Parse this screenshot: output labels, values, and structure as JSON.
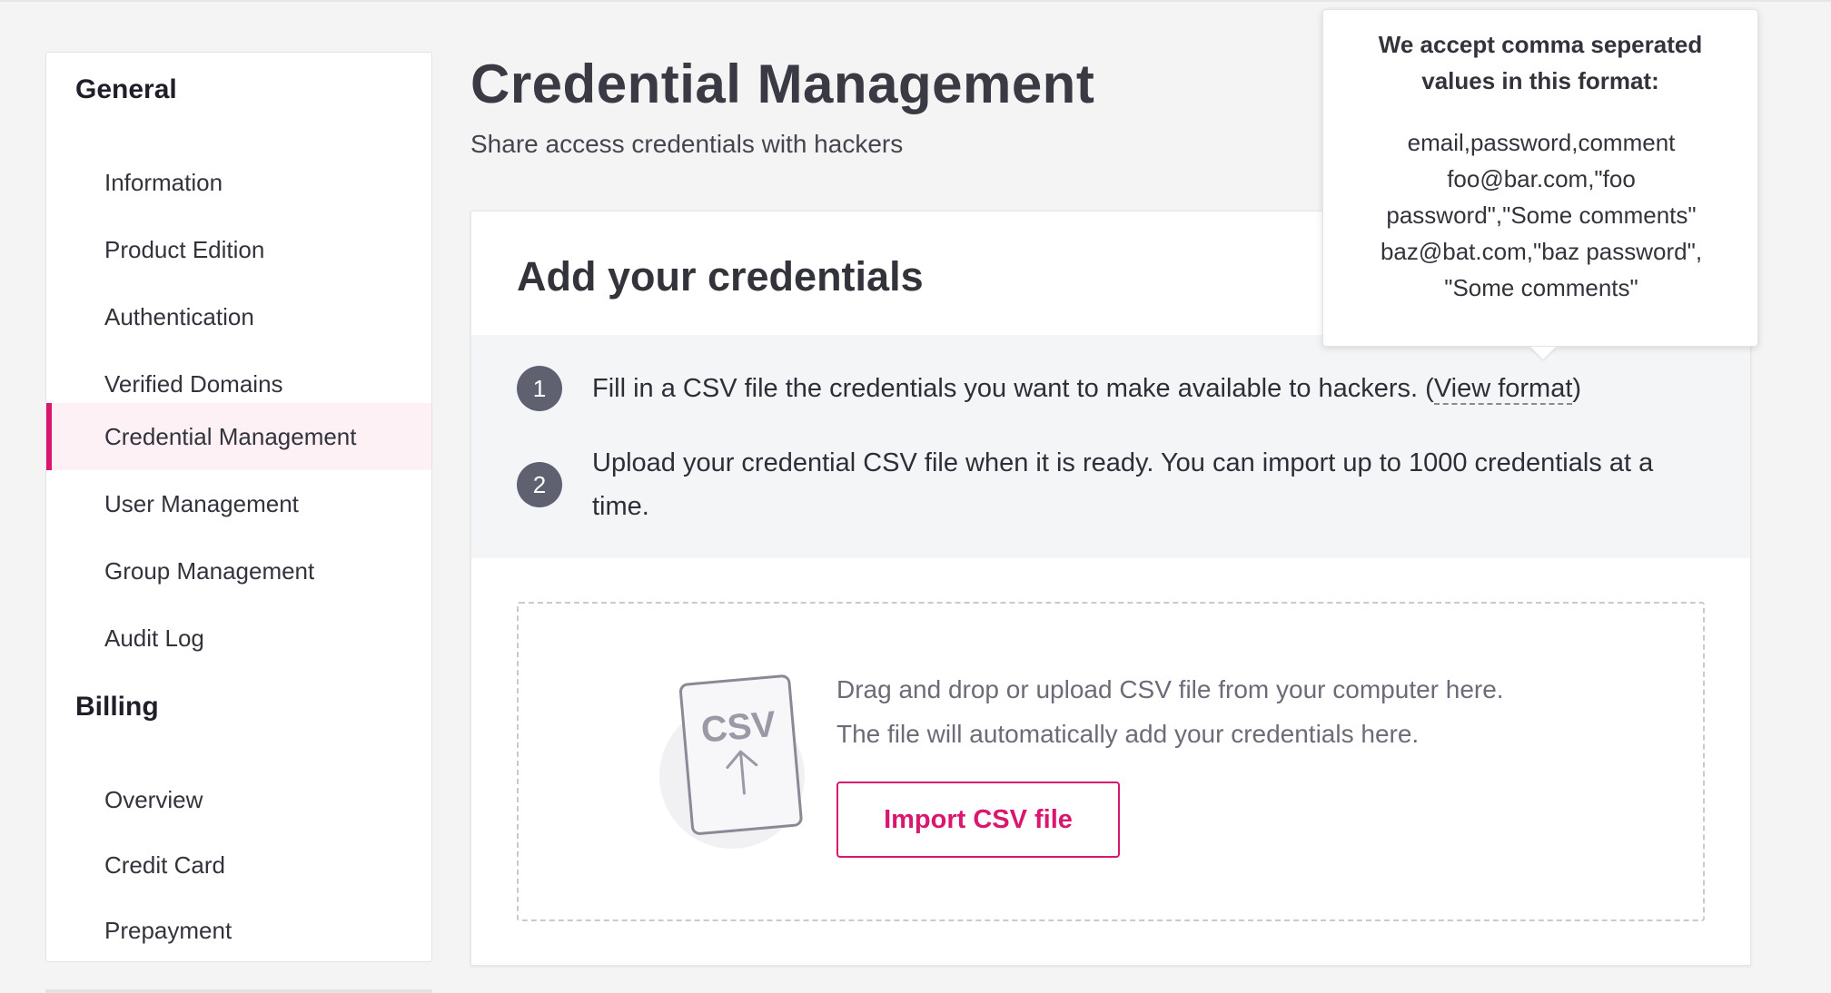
{
  "sidebar": {
    "sections": [
      {
        "title": "General",
        "items": [
          {
            "label": "Information"
          },
          {
            "label": "Product Edition"
          },
          {
            "label": "Authentication"
          },
          {
            "label": "Verified Domains"
          },
          {
            "label": "Credential Management",
            "active": true
          },
          {
            "label": "User Management"
          },
          {
            "label": "Group Management"
          },
          {
            "label": "Audit Log"
          }
        ]
      },
      {
        "title": "Billing",
        "items": [
          {
            "label": "Overview"
          },
          {
            "label": "Credit Card"
          },
          {
            "label": "Prepayment"
          }
        ]
      }
    ]
  },
  "header": {
    "title": "Credential Management",
    "subtitle": "Share access credentials with hackers"
  },
  "card": {
    "title": "Add your credentials",
    "steps": [
      {
        "number": "1",
        "text": "Fill in a CSV file the credentials you want to make available to hackers. (",
        "link": "View format",
        "suffix": ")"
      },
      {
        "number": "2",
        "text": "Upload your credential CSV file when it is ready. You can import up to 1000 credentials at a time."
      }
    ],
    "dropzone": {
      "icon": "csv-upload-icon",
      "icon_label": "CSV",
      "line1": "Drag and drop or upload CSV file from your computer here.",
      "line2": "The file will automatically add your credentials here.",
      "button": "Import CSV file"
    }
  },
  "tooltip": {
    "title": "We accept comma seperated values in this format:",
    "lines": [
      "email,password,comment",
      "foo@bar.com,\"foo password\",\"Some comments\"",
      "baz@bat.com,\"baz password\", \"Some comments\""
    ]
  },
  "colors": {
    "accent": "#d9176f",
    "step_badge": "#5f6070",
    "background": "#f4f4f4",
    "active_item_bg": "#fdf1f5"
  }
}
